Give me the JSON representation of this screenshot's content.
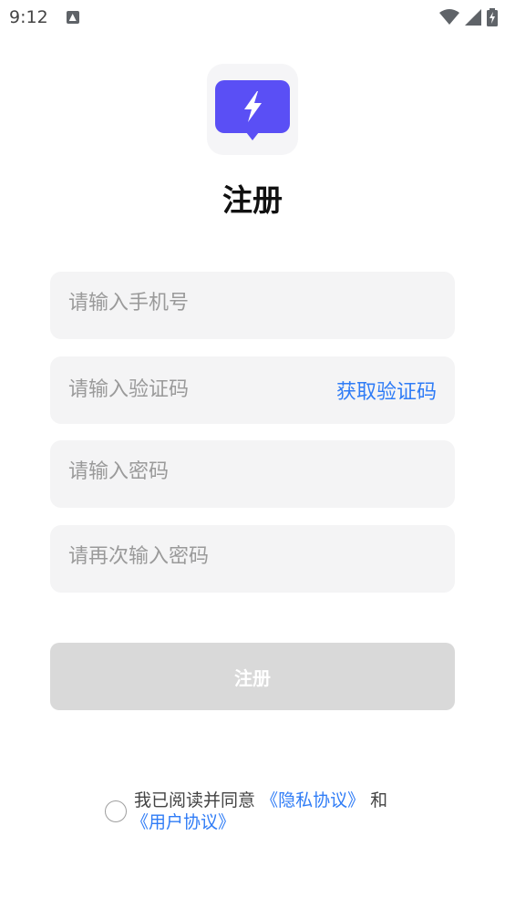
{
  "status_bar": {
    "time": "9:12",
    "icons": [
      "notification-a-icon",
      "wifi-icon",
      "signal-icon",
      "battery-charging-icon"
    ]
  },
  "logo": {
    "icon": "lightning-chat-bubble-icon",
    "bg_color": "#5a4ff5"
  },
  "title": "注册",
  "form": {
    "phone_placeholder": "请输入手机号",
    "code_placeholder": "请输入验证码",
    "get_code_label": "获取验证码",
    "password_placeholder": "请输入密码",
    "password_confirm_placeholder": "请再次输入密码"
  },
  "register_button": {
    "label": "注册"
  },
  "agreement": {
    "prefix": "我已阅读并同意",
    "privacy_link": "《隐私协议》",
    "and": "和",
    "user_link": "《用户协议》"
  },
  "colors": {
    "accent_link": "#2f7cf6",
    "input_bg": "#f4f4f5",
    "button_disabled_bg": "#d9d9d9",
    "logo_purple": "#5a4ff5"
  }
}
